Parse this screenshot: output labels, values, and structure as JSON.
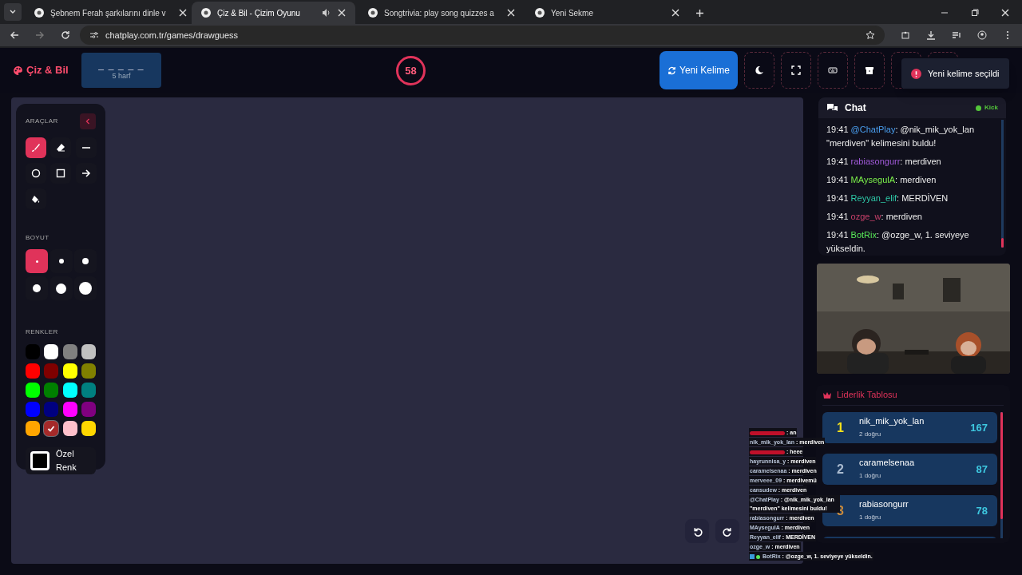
{
  "browser": {
    "tabs": [
      {
        "title": "Şebnem Ferah şarkılarını dinle v",
        "selected": false,
        "audio": false
      },
      {
        "title": "Çiz & Bil - Çizim Oyunu",
        "selected": true,
        "audio": true
      },
      {
        "title": "Songtrivia: play song quizzes a",
        "selected": false,
        "audio": false
      },
      {
        "title": "Yeni Sekme",
        "selected": false,
        "audio": false
      }
    ],
    "address": "chatplay.com.tr/games/drawguess"
  },
  "header": {
    "logo": "Çiz & Bil",
    "word_hint": "_ _ _ _ _",
    "letter_count": "5 harf",
    "timer": "58",
    "new_word_button": "Yeni Kelime"
  },
  "toast": "Yeni kelime seçildi",
  "tools": {
    "title": "ARAÇLAR",
    "items": [
      {
        "kind": "pen",
        "selected": true
      },
      {
        "kind": "eraser",
        "selected": false
      },
      {
        "kind": "line",
        "selected": false
      },
      {
        "kind": "circle",
        "selected": false
      },
      {
        "kind": "rect",
        "selected": false
      },
      {
        "kind": "arrow",
        "selected": false
      },
      {
        "kind": "fill",
        "selected": false
      }
    ],
    "size_title": "BOYUT",
    "sizes": [
      {
        "selected": true
      },
      {
        "selected": false
      },
      {
        "selected": false
      },
      {
        "selected": false
      },
      {
        "selected": false
      },
      {
        "selected": false
      }
    ],
    "colors_title": "RENKLER",
    "colors": [
      {
        "color": "#000000",
        "selected": false
      },
      {
        "color": "#ffffff",
        "selected": false
      },
      {
        "color": "#808080",
        "selected": false
      },
      {
        "color": "#c0c0c0",
        "selected": false
      },
      {
        "color": "#ff0000",
        "selected": false
      },
      {
        "color": "#800000",
        "selected": false
      },
      {
        "color": "#ffff00",
        "selected": false
      },
      {
        "color": "#808000",
        "selected": false
      },
      {
        "color": "#00ff00",
        "selected": false
      },
      {
        "color": "#008000",
        "selected": false
      },
      {
        "color": "#00ffff",
        "selected": false
      },
      {
        "color": "#008080",
        "selected": false
      },
      {
        "color": "#0000ff",
        "selected": false
      },
      {
        "color": "#000080",
        "selected": false
      },
      {
        "color": "#ff00ff",
        "selected": false
      },
      {
        "color": "#800080",
        "selected": false
      },
      {
        "color": "#ffa500",
        "selected": false
      },
      {
        "color": "#a52a2a",
        "selected": true
      },
      {
        "color": "#ffc0cb",
        "selected": false
      },
      {
        "color": "#ffd700",
        "selected": false
      }
    ],
    "custom_color": "Özel Renk"
  },
  "chat": {
    "title": "Chat",
    "source": "Kick",
    "messages": [
      {
        "time": "19:41",
        "user": "@ChatPlay",
        "color": "#4a9ff0",
        "text": ": @nik_mik_yok_lan \"merdiven\" kelimesini buldu!"
      },
      {
        "time": "19:41",
        "user": "rabiasongurr",
        "color": "#a05ad8",
        "text": ": merdiven"
      },
      {
        "time": "19:41",
        "user": "MAysegulA",
        "color": "#7cf04a",
        "text": ": merdiven"
      },
      {
        "time": "19:41",
        "user": "Reyyan_elif",
        "color": "#2ec9a8",
        "text": ": MERDİVEN"
      },
      {
        "time": "19:41",
        "user": "ozge_w",
        "color": "#c8406a",
        "text": ": merdiven"
      },
      {
        "time": "19:41",
        "user": "BotRix",
        "color": "#58e858",
        "text": ": @ozge_w, 1. seviyeye yükseldin."
      }
    ]
  },
  "leaderboard": {
    "title": "Liderlik Tablosu",
    "rows": [
      {
        "rank": "1",
        "name": "nik_mik_yok_lan",
        "correct": "2 doğru",
        "score": "167",
        "color": "#f5e11b"
      },
      {
        "rank": "2",
        "name": "caramelsenaa",
        "correct": "1 doğru",
        "score": "87",
        "color": "#aabbd0"
      },
      {
        "rank": "3",
        "name": "rabiasongurr",
        "correct": "1 doğru",
        "score": "78",
        "color": "#c98a3c"
      }
    ]
  },
  "overlay_chat": [
    {
      "kind": "redacted",
      "color": "#c0102a",
      "text": ": an"
    },
    {
      "kind": "plain",
      "user": "nik_mik_yok_lan",
      "text": ": merdiven"
    },
    {
      "kind": "redacted",
      "color": "#c0102a",
      "text": ": heee"
    },
    {
      "kind": "plain",
      "user": "hayrunnisa_y",
      "text": ": merdiven"
    },
    {
      "kind": "plain",
      "user": "caramelsenaa",
      "text": ": merdiven"
    },
    {
      "kind": "plain",
      "user": "merveee_09",
      "text": ": merdivemü"
    },
    {
      "kind": "plain",
      "user": "cansudew",
      "text": ": merdiven"
    },
    {
      "kind": "plain",
      "user": "@ChatPlay",
      "text": ": @nik_mik_yok_lan \"merdiven\" kelimesini buldu!"
    },
    {
      "kind": "plain",
      "user": "rabiasongurr",
      "text": ": merdiven"
    },
    {
      "kind": "plain",
      "user": "MAysegulA",
      "text": ": merdiven"
    },
    {
      "kind": "plain",
      "user": "Reyyan_elif",
      "text": ": MERDİVEN"
    },
    {
      "kind": "plain",
      "user": "ozge_w",
      "text": ": merdiven"
    },
    {
      "kind": "badged",
      "user": "BotRix",
      "text": ": @ozge_w, 1. seviyeye yükseldin."
    }
  ]
}
